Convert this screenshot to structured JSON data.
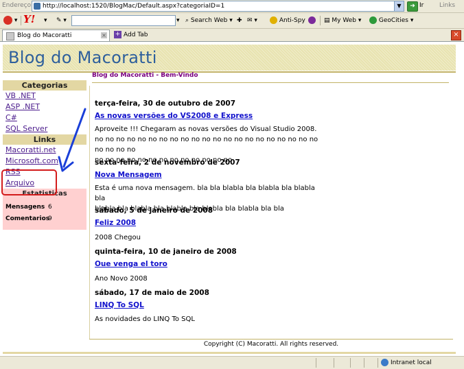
{
  "browser": {
    "address_label": "Endereço",
    "url": "http://localhost:1520/BlogMac/Default.aspx?categoriaID=1",
    "go_label": "Ir",
    "links_label": "Links",
    "toolbar": {
      "yahoo_logo": "Y!",
      "search_web": "Search Web",
      "anti_spy": "Anti-Spy",
      "my_web": "My Web",
      "geocities": "GeoCities"
    },
    "tab_title": "Blog do Macoratti",
    "add_tab": "Add Tab",
    "status_zone": "Intranet local"
  },
  "page": {
    "header_title": "Blog do Macoratti",
    "welcome": "Blog do Macoratti - Bem-Vindo",
    "sidebar": {
      "categories_title": "Categorias",
      "categories": [
        "VB .NET",
        "ASP .NET",
        "C#",
        "SQL Server"
      ],
      "links_title": "Links",
      "links": [
        "Macoratti.net",
        "Microsoft.com",
        "RSS",
        "Arquivo"
      ],
      "stats_title": "Estatisticas",
      "stats": [
        {
          "label": "Mensagens",
          "value": "6"
        },
        {
          "label": "Comentarios",
          "value": "9"
        }
      ]
    },
    "posts": [
      {
        "date": "terça-feira, 30 de outubro de 2007",
        "title": "As novas versões do VS2008 e Express",
        "body_lines": [
          "Aproveite !!! Chegaram as novas versões do Visual Studio 2008.",
          "no no no no no no no no no no no no no no no no no no no no no no no no no",
          "no no no no no no no no no no no no no"
        ]
      },
      {
        "date": "sexta-feira, 2 de novembro de 2007",
        "title": "Nova Mensagem",
        "body_lines": [
          "Esta é uma nova mensagem. bla bla blabla bla blabla bla blabla bla",
          "blabla bla blabla bla blabla bla blabla bla blabla bla bla"
        ]
      },
      {
        "date": "sábado, 5 de janeiro de 2008",
        "title": "Feliz 2008",
        "body_lines": [
          "2008 Chegou"
        ]
      },
      {
        "date": "quinta-feira, 10 de janeiro de 2008",
        "title": "Oue venga el toro",
        "body_lines": [
          "Ano Novo 2008"
        ]
      },
      {
        "date": "sábado, 17 de maio de 2008",
        "title": "LINQ To SQL",
        "body_lines": [
          "As novidades do LINQ To SQL"
        ]
      }
    ],
    "footer": "Copyright (C) Macoratti. All rights reserved."
  },
  "colors": {
    "header_bg": "#e8e3b0",
    "header_title": "#2e5f9c",
    "sidebar_section": "#e3d7a3",
    "stats_bg": "#ffd0d0",
    "link": "#4b1b8c",
    "post_link": "#1111cc",
    "welcome": "#7a0080",
    "annotation": "#d31b1b",
    "arrow": "#1a3fd8"
  }
}
